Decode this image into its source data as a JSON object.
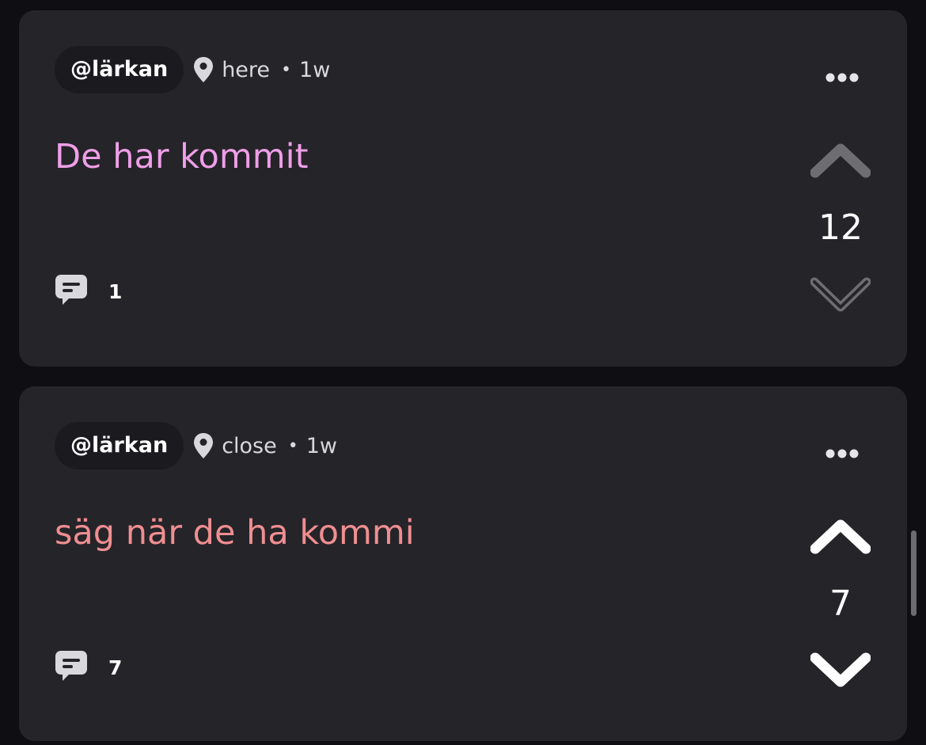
{
  "posts": [
    {
      "handle": "@lärkan",
      "location": "here",
      "separator": "•",
      "age": "1w",
      "text": "De har kommit",
      "text_color": "#ef9fe8",
      "comment_count": "1",
      "score": "12",
      "upvote_state": "neutral",
      "downvote_state": "neutral-outline"
    },
    {
      "handle": "@lärkan",
      "location": "close",
      "separator": "•",
      "age": "1w",
      "text": "säg när de ha kommi",
      "text_color": "#ef8e91",
      "comment_count": "7",
      "score": "7",
      "upvote_state": "active",
      "downvote_state": "active"
    }
  ],
  "icons": {
    "location": "location-pin-icon",
    "more": "more-options-icon",
    "comment": "comment-bubble-icon",
    "upvote": "chevron-up-icon",
    "downvote": "chevron-down-icon"
  },
  "colors": {
    "background": "#0f0e13",
    "card": "#252429",
    "handle_pill": "#1b1a1f",
    "vote_inactive": "#6e6e72",
    "vote_active": "#ffffff"
  }
}
